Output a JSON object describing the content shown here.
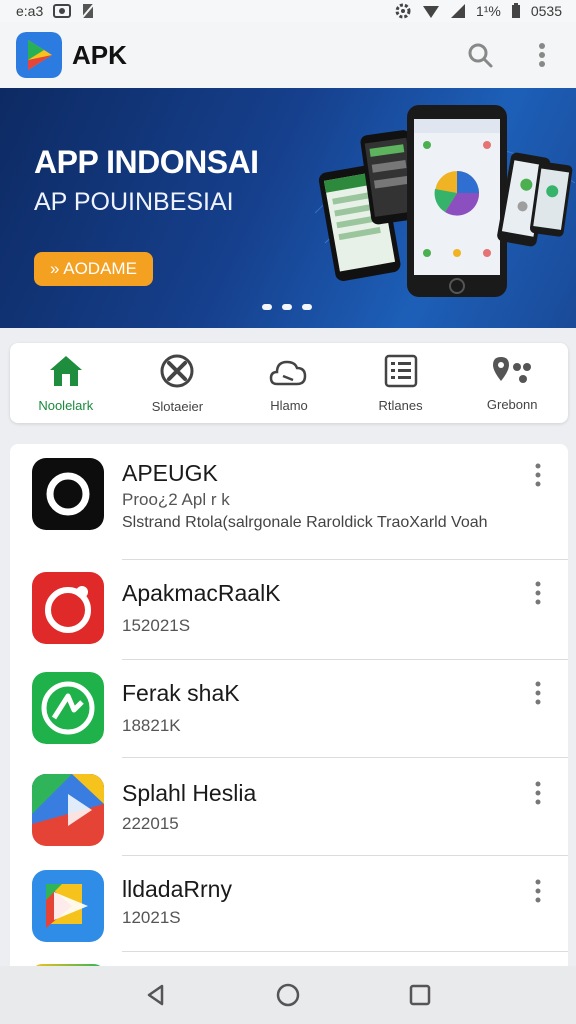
{
  "status_bar": {
    "time": "e:a3",
    "battery": "1¹%",
    "clock_right": "0535"
  },
  "app_bar": {
    "title": "APK",
    "icons": [
      "apk-logo",
      "search-icon",
      "more-vert-icon"
    ]
  },
  "banner": {
    "title": "APP INDONSAI",
    "subtitle": "AP POUINBESIAI",
    "button_label": "» AODAME",
    "page_dots": 3
  },
  "categories": [
    {
      "label": "Noolelark",
      "icon": "home-icon",
      "active": true
    },
    {
      "label": "Slotaeier",
      "icon": "tools-icon",
      "active": false
    },
    {
      "label": "Hlamo",
      "icon": "cloud-device-icon",
      "active": false
    },
    {
      "label": "Rtlanes",
      "icon": "list-icon",
      "active": false
    },
    {
      "label": "Grebonn",
      "icon": "location-dots-icon",
      "active": false
    }
  ],
  "apps": [
    {
      "name": "APEUGK",
      "sub": "Proo¿2 Apl r k",
      "desc": "Slstrand Rtola(salrgonale Raroldick TraoXarld Voah",
      "icon": "circle-app-icon",
      "color": "#0d0d0d"
    },
    {
      "name": "ApakmacRaalK",
      "sub": "152021S",
      "desc": "",
      "icon": "red-bubble-app-icon",
      "color": "#e02a2a"
    },
    {
      "name": "Ferak shaK",
      "sub": "18821K",
      "desc": "",
      "icon": "green-arrow-app-icon",
      "color": "#20b24a"
    },
    {
      "name": "Splahl Heslia",
      "sub": "222015",
      "desc": "",
      "icon": "play-triangle-app-icon",
      "color": "#3a7de0"
    },
    {
      "name": "lldadaRrny",
      "sub": "12021S",
      "desc": "",
      "icon": "folder-play-app-icon",
      "color": "#2f8de8"
    }
  ],
  "nav": {
    "icons": [
      "back-icon",
      "home-circle-icon",
      "recents-icon"
    ]
  }
}
